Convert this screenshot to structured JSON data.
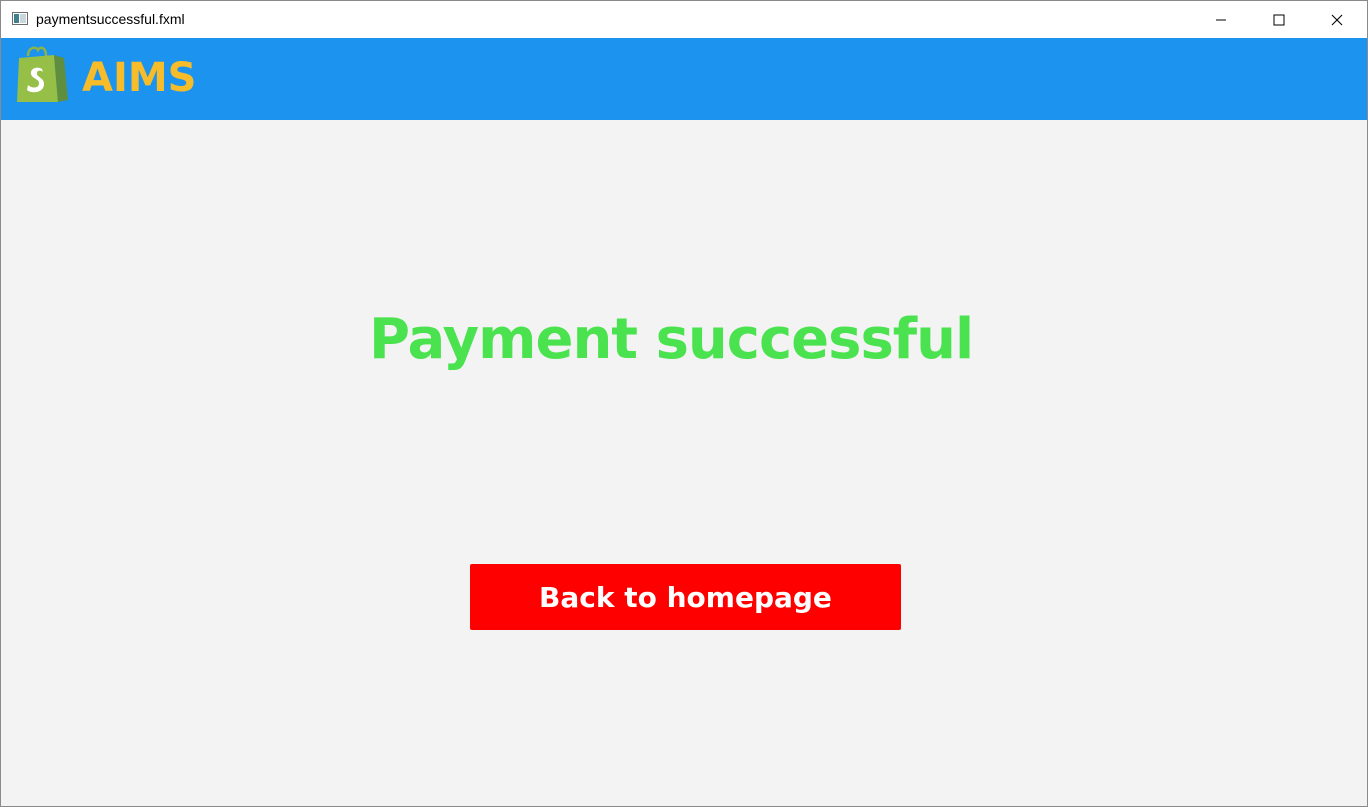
{
  "window": {
    "title": "paymentsuccessful.fxml",
    "icons": {
      "app": "window-app-icon",
      "minimize": "minimize-icon",
      "maximize": "maximize-icon",
      "close": "close-icon"
    }
  },
  "header": {
    "brand": "AIMS",
    "logo_icon": "shopping-bag-logo-icon",
    "background_color": "#1c93ee",
    "brand_color": "#f6bc2a"
  },
  "main": {
    "message": "Payment successful",
    "message_color": "#4ae24f",
    "back_button_label": "Back to homepage",
    "back_button_color": "#ff0000"
  }
}
